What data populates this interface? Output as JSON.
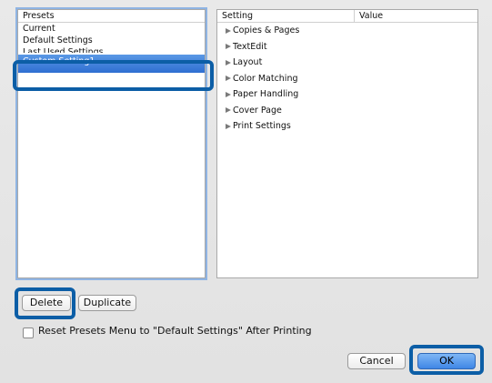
{
  "presets": {
    "header": "Presets",
    "items": [
      {
        "label": "Current"
      },
      {
        "label": "Default Settings"
      },
      {
        "label": "Last Used Settings"
      },
      {
        "label": "Custom Setting1"
      }
    ]
  },
  "settings": {
    "header_setting": "Setting",
    "header_value": "Value",
    "items": [
      {
        "label": "Copies & Pages"
      },
      {
        "label": "TextEdit"
      },
      {
        "label": "Layout"
      },
      {
        "label": "Color Matching"
      },
      {
        "label": "Paper Handling"
      },
      {
        "label": "Cover Page"
      },
      {
        "label": "Print Settings"
      }
    ]
  },
  "buttons": {
    "delete": "Delete",
    "duplicate": "Duplicate",
    "cancel": "Cancel",
    "ok": "OK"
  },
  "checkbox": {
    "label": "Reset Presets Menu to \"Default Settings\" After Printing",
    "checked": false
  },
  "colors": {
    "selection": "#3a7bd8",
    "highlight_border": "#0c5ea6"
  }
}
